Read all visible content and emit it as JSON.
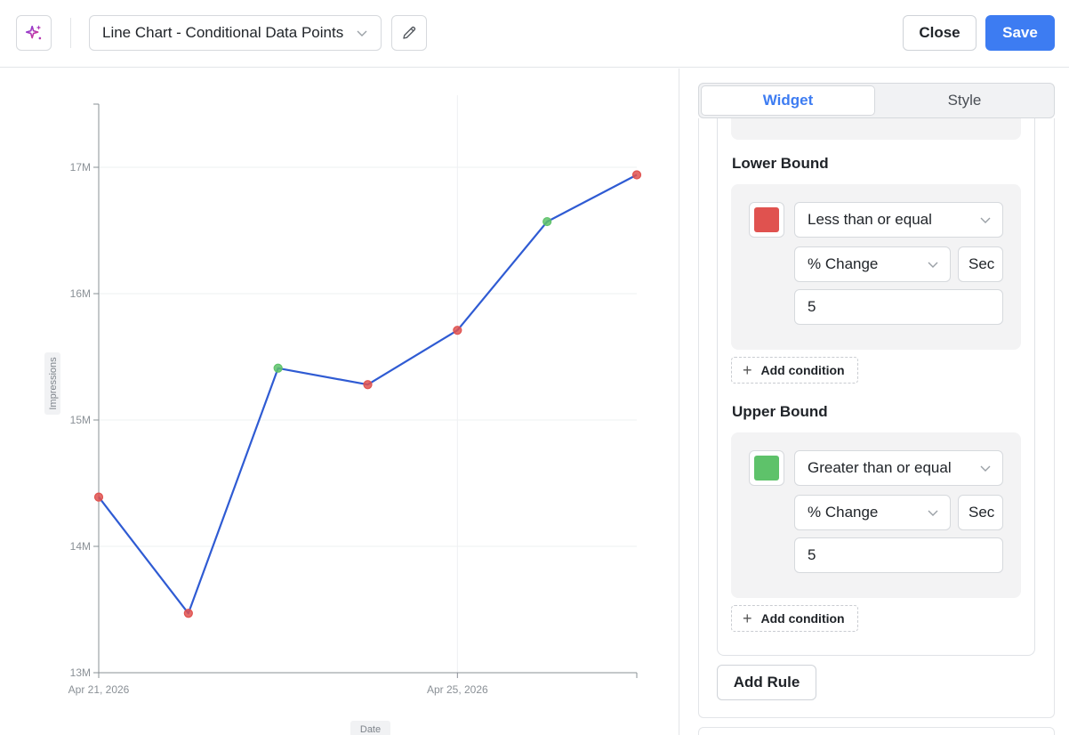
{
  "header": {
    "chart_title": "Line Chart - Conditional Data Points",
    "close_label": "Close",
    "save_label": "Save",
    "icons": [
      "sparkle-icon",
      "chevron-down-icon",
      "pencil-icon"
    ]
  },
  "tabs": [
    {
      "label": "Widget",
      "active": true
    },
    {
      "label": "Style",
      "active": false
    }
  ],
  "rule": {
    "lower": {
      "title": "Lower Bound",
      "color": "#e0524f",
      "operator": "Less than or equal",
      "measure": "% Change",
      "compare": "Sec",
      "value": "5",
      "add_condition": "Add condition"
    },
    "upper": {
      "title": "Upper Bound",
      "color": "#5ec26a",
      "operator": "Greater than or equal",
      "measure": "% Change",
      "compare": "Sec",
      "value": "5",
      "add_condition": "Add condition"
    }
  },
  "add_rule_label": "Add Rule",
  "chart_data": {
    "type": "line",
    "xlabel": "Date",
    "ylabel": "Impressions",
    "ylim": [
      13,
      17.5
    ],
    "yunit": "M",
    "yticks": [
      13,
      14,
      15,
      16,
      17
    ],
    "ytick_labels": [
      "13M",
      "14M",
      "15M",
      "16M",
      "17M"
    ],
    "x": [
      "2026-04-21",
      "2026-04-22",
      "2026-04-23",
      "2026-04-24",
      "2026-04-25",
      "2026-04-26",
      "2026-04-27"
    ],
    "xtick_labels": [
      {
        "index": 0,
        "label": "Apr 21, 2026"
      },
      {
        "index": 4,
        "label": "Apr 25, 2026"
      }
    ],
    "series": [
      {
        "values": [
          14.39,
          13.47,
          15.41,
          15.28,
          15.71,
          16.57,
          16.94
        ],
        "point_status": [
          "low",
          "low",
          "high",
          "low",
          "low",
          "high",
          "low"
        ]
      }
    ],
    "line_color": "#2f5bd3",
    "point_colors": {
      "low": "#e0524f",
      "high": "#5ec26a"
    },
    "grid": true
  }
}
